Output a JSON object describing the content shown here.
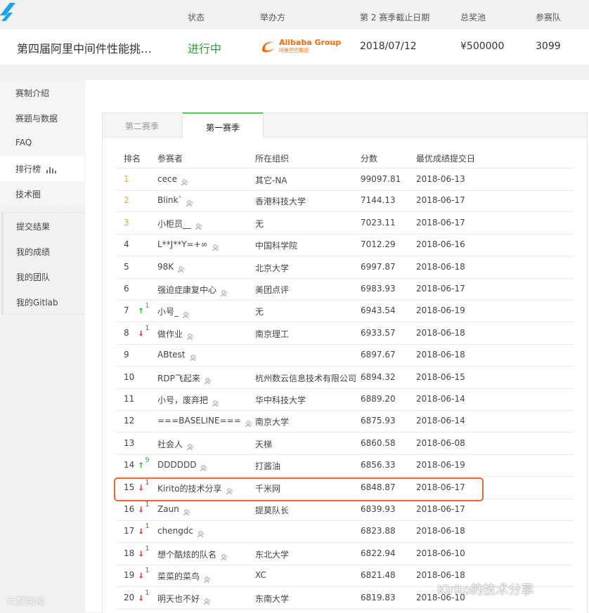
{
  "header": {
    "col_labels": {
      "status": "状态",
      "organizer": "举办方",
      "deadline": "第 2 赛季截止日期",
      "prize": "总奖池",
      "teams": "参赛队"
    },
    "competition_title": "第四届阿里中间件性能挑…",
    "status": "进行中",
    "organizer_logo_text": "Alibaba Group",
    "organizer_logo_cn": "阿里巴巴集团",
    "deadline": "2018/07/12",
    "prize": "¥500000",
    "teams": "3099"
  },
  "sidebar": {
    "items": [
      {
        "label": "赛制介绍"
      },
      {
        "label": "赛题与数据"
      },
      {
        "label": "FAQ"
      },
      {
        "label": "排行榜"
      },
      {
        "label": "技术圈"
      }
    ],
    "sub_items": [
      {
        "label": "提交结果"
      },
      {
        "label": "我的成绩"
      },
      {
        "label": "我的团队"
      },
      {
        "label": "我的Gitlab"
      }
    ]
  },
  "tabs": [
    {
      "label": "第二赛季"
    },
    {
      "label": "第一赛季"
    }
  ],
  "table": {
    "headers": [
      "排名",
      "参赛者",
      "所在组织",
      "分数",
      "最优成绩提交日"
    ],
    "rows": [
      {
        "rank": "1",
        "change": "",
        "dir": "",
        "name": "cece",
        "org": "其它-NA",
        "score": "99097.81",
        "date": "2018-06-13"
      },
      {
        "rank": "2",
        "change": "",
        "dir": "",
        "name": "Blink`",
        "org": "香港科技大学",
        "score": "7144.13",
        "date": "2018-06-17"
      },
      {
        "rank": "3",
        "change": "",
        "dir": "",
        "name": "小柜员__",
        "org": "无",
        "score": "7023.11",
        "date": "2018-06-17"
      },
      {
        "rank": "4",
        "change": "",
        "dir": "",
        "name": "L**J**Y=+∞",
        "org": "中国科学院",
        "score": "7012.29",
        "date": "2018-06-16"
      },
      {
        "rank": "5",
        "change": "",
        "dir": "",
        "name": "98K",
        "org": "北京大学",
        "score": "6997.87",
        "date": "2018-06-18"
      },
      {
        "rank": "6",
        "change": "",
        "dir": "",
        "name": "强迫症康复中心",
        "org": "美团点评",
        "score": "6983.93",
        "date": "2018-06-17"
      },
      {
        "rank": "7",
        "change": "1",
        "dir": "up",
        "name": "小号_",
        "org": "无",
        "score": "6943.54",
        "date": "2018-06-19"
      },
      {
        "rank": "8",
        "change": "1",
        "dir": "down",
        "name": "做作业",
        "org": "南京理工",
        "score": "6933.57",
        "date": "2018-06-18"
      },
      {
        "rank": "9",
        "change": "",
        "dir": "",
        "name": "ABtest",
        "org": "",
        "score": "6897.67",
        "date": "2018-06-18"
      },
      {
        "rank": "10",
        "change": "",
        "dir": "",
        "name": "RDP飞起来",
        "org": "杭州数云信息技术有限公司",
        "score": "6894.32",
        "date": "2018-06-15"
      },
      {
        "rank": "11",
        "change": "",
        "dir": "",
        "name": "小号，废弃把",
        "org": "华中科技大学",
        "score": "6889.20",
        "date": "2018-06-14"
      },
      {
        "rank": "12",
        "change": "",
        "dir": "",
        "name": "===BASELINE===",
        "org": "南京大学",
        "score": "6875.93",
        "date": "2018-06-14"
      },
      {
        "rank": "13",
        "change": "",
        "dir": "",
        "name": "社会人",
        "org": "天梯",
        "score": "6860.58",
        "date": "2018-06-08"
      },
      {
        "rank": "14",
        "change": "9",
        "dir": "up",
        "name": "DDDDDD",
        "org": "打酱油",
        "score": "6856.33",
        "date": "2018-06-19"
      },
      {
        "rank": "15",
        "change": "1",
        "dir": "down",
        "name": "Kirito的技术分享",
        "org": "千米网",
        "score": "6848.87",
        "date": "2018-06-17"
      },
      {
        "rank": "16",
        "change": "1",
        "dir": "down",
        "name": "Zaun",
        "org": "提莫队长",
        "score": "6839.93",
        "date": "2018-06-17"
      },
      {
        "rank": "17",
        "change": "1",
        "dir": "down",
        "name": "chengdc",
        "org": "",
        "score": "6823.88",
        "date": "2018-06-18"
      },
      {
        "rank": "18",
        "change": "1",
        "dir": "down",
        "name": "想个酷炫的队名",
        "org": "东北大学",
        "score": "6822.94",
        "date": "2018-06-10"
      },
      {
        "rank": "19",
        "change": "1",
        "dir": "down",
        "name": "菜菜的菜鸟",
        "org": "XC",
        "score": "6821.48",
        "date": "2018-06-18"
      },
      {
        "rank": "20",
        "change": "1",
        "dir": "down",
        "name": "明天也不好",
        "org": "东南大学",
        "score": "6819.83",
        "date": "2018-06-10"
      }
    ]
  },
  "watermarks": {
    "left": "大数跨境",
    "right": "Kirito的技术分享"
  },
  "colors": {
    "status_green": "#2e9c3b",
    "tab_accent": "#5cc85c",
    "top3_rank": "#f0a830",
    "rank_up": "#37b24d",
    "rank_down": "#e03131",
    "highlight": "#e06a3a"
  }
}
